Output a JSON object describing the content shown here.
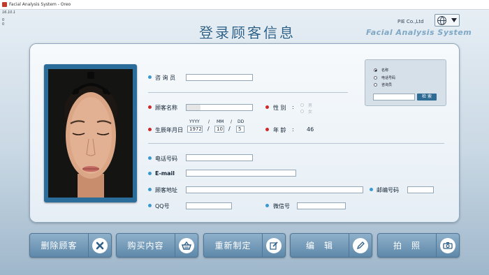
{
  "window": {
    "title": "Facial Analysis System - Oreo"
  },
  "version_text": "16.10.1",
  "debug_lines": [
    "0",
    "0"
  ],
  "header": {
    "title": "登录顾客信息",
    "company": "PIE Co.,Ltd",
    "system_name": "Facial Analysis System"
  },
  "form": {
    "consultant": {
      "label": "咨 询 员",
      "value": ""
    },
    "customer_name": {
      "label": "顾客名称",
      "value": ""
    },
    "gender": {
      "label": "性 别",
      "options": [
        "男",
        "女"
      ]
    },
    "birthday": {
      "label": "生辰年月日",
      "year_label": "YYYY",
      "month_label": "MM",
      "day_label": "DD",
      "year": "1972",
      "month": "10",
      "day": "5",
      "sep": "/"
    },
    "age": {
      "label": "年 龄",
      "value": "46"
    },
    "phone": {
      "label": "电话号码",
      "value": ""
    },
    "email": {
      "label": "E-mail",
      "value": ""
    },
    "address": {
      "label": "顾客地址",
      "value": ""
    },
    "postcode": {
      "label": "邮编号码",
      "value": ""
    },
    "qq": {
      "label": "QQ号",
      "value": ""
    },
    "wechat": {
      "label": "微信号",
      "value": ""
    }
  },
  "search": {
    "options": [
      "名称",
      "电话号码",
      "咨询员"
    ],
    "selected": "名称",
    "query": "",
    "button": "检 索"
  },
  "actions": [
    {
      "label": "删除顾客",
      "icon": "x-icon"
    },
    {
      "label": "购买内容",
      "icon": "basket-icon"
    },
    {
      "label": "重新制定",
      "icon": "edit-icon"
    },
    {
      "label": "编　辑",
      "icon": "pencil-icon"
    },
    {
      "label": "拍　照",
      "icon": "camera-icon"
    }
  ],
  "colors": {
    "accent": "#2a5f87",
    "required": "#d02a2a",
    "optional": "#3a9ad0"
  }
}
